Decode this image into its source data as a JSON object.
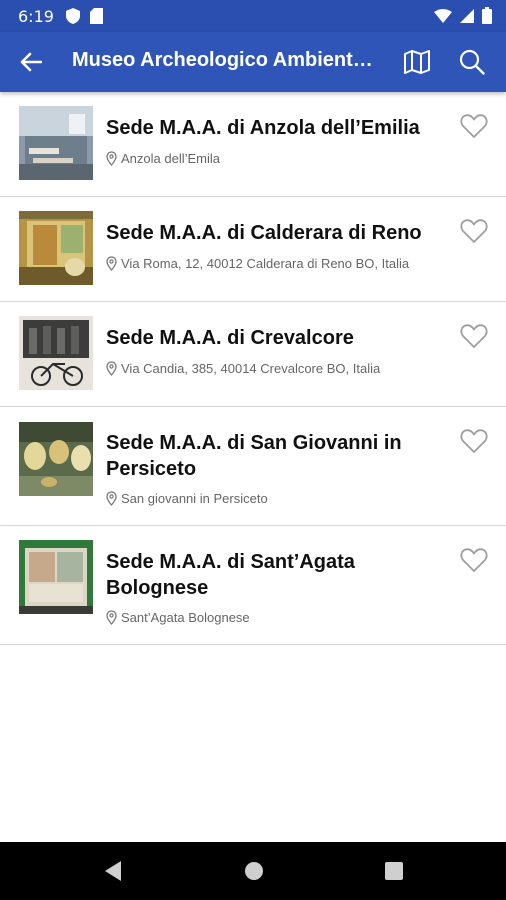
{
  "status_bar": {
    "time": "6:19"
  },
  "app_bar": {
    "title": "Museo Archeologico Ambient…"
  },
  "colors": {
    "primary": "#2f55b8",
    "status_bar": "#2a4fb0"
  },
  "items": [
    {
      "title": "Sede M.A.A. di Anzola dell’Emilia",
      "address": "Anzola dell’Emila"
    },
    {
      "title": "Sede M.A.A. di Calderara di Reno",
      "address": "Via Roma, 12, 40012 Calderara di Reno BO, Italia"
    },
    {
      "title": "Sede M.A.A. di Crevalcore",
      "address": "Via Candia, 385, 40014 Crevalcore BO, Italia"
    },
    {
      "title": "Sede M.A.A. di San Giovanni in Persiceto",
      "address": "San giovanni in Persiceto"
    },
    {
      "title": "Sede M.A.A. di Sant’Agata Bolognese",
      "address": "Sant’Agata Bolognese"
    }
  ],
  "icons": {
    "back": "arrow-back-icon",
    "map": "map-icon",
    "search": "search-icon",
    "favorite": "heart-outline-icon",
    "location": "location-pin-icon"
  }
}
